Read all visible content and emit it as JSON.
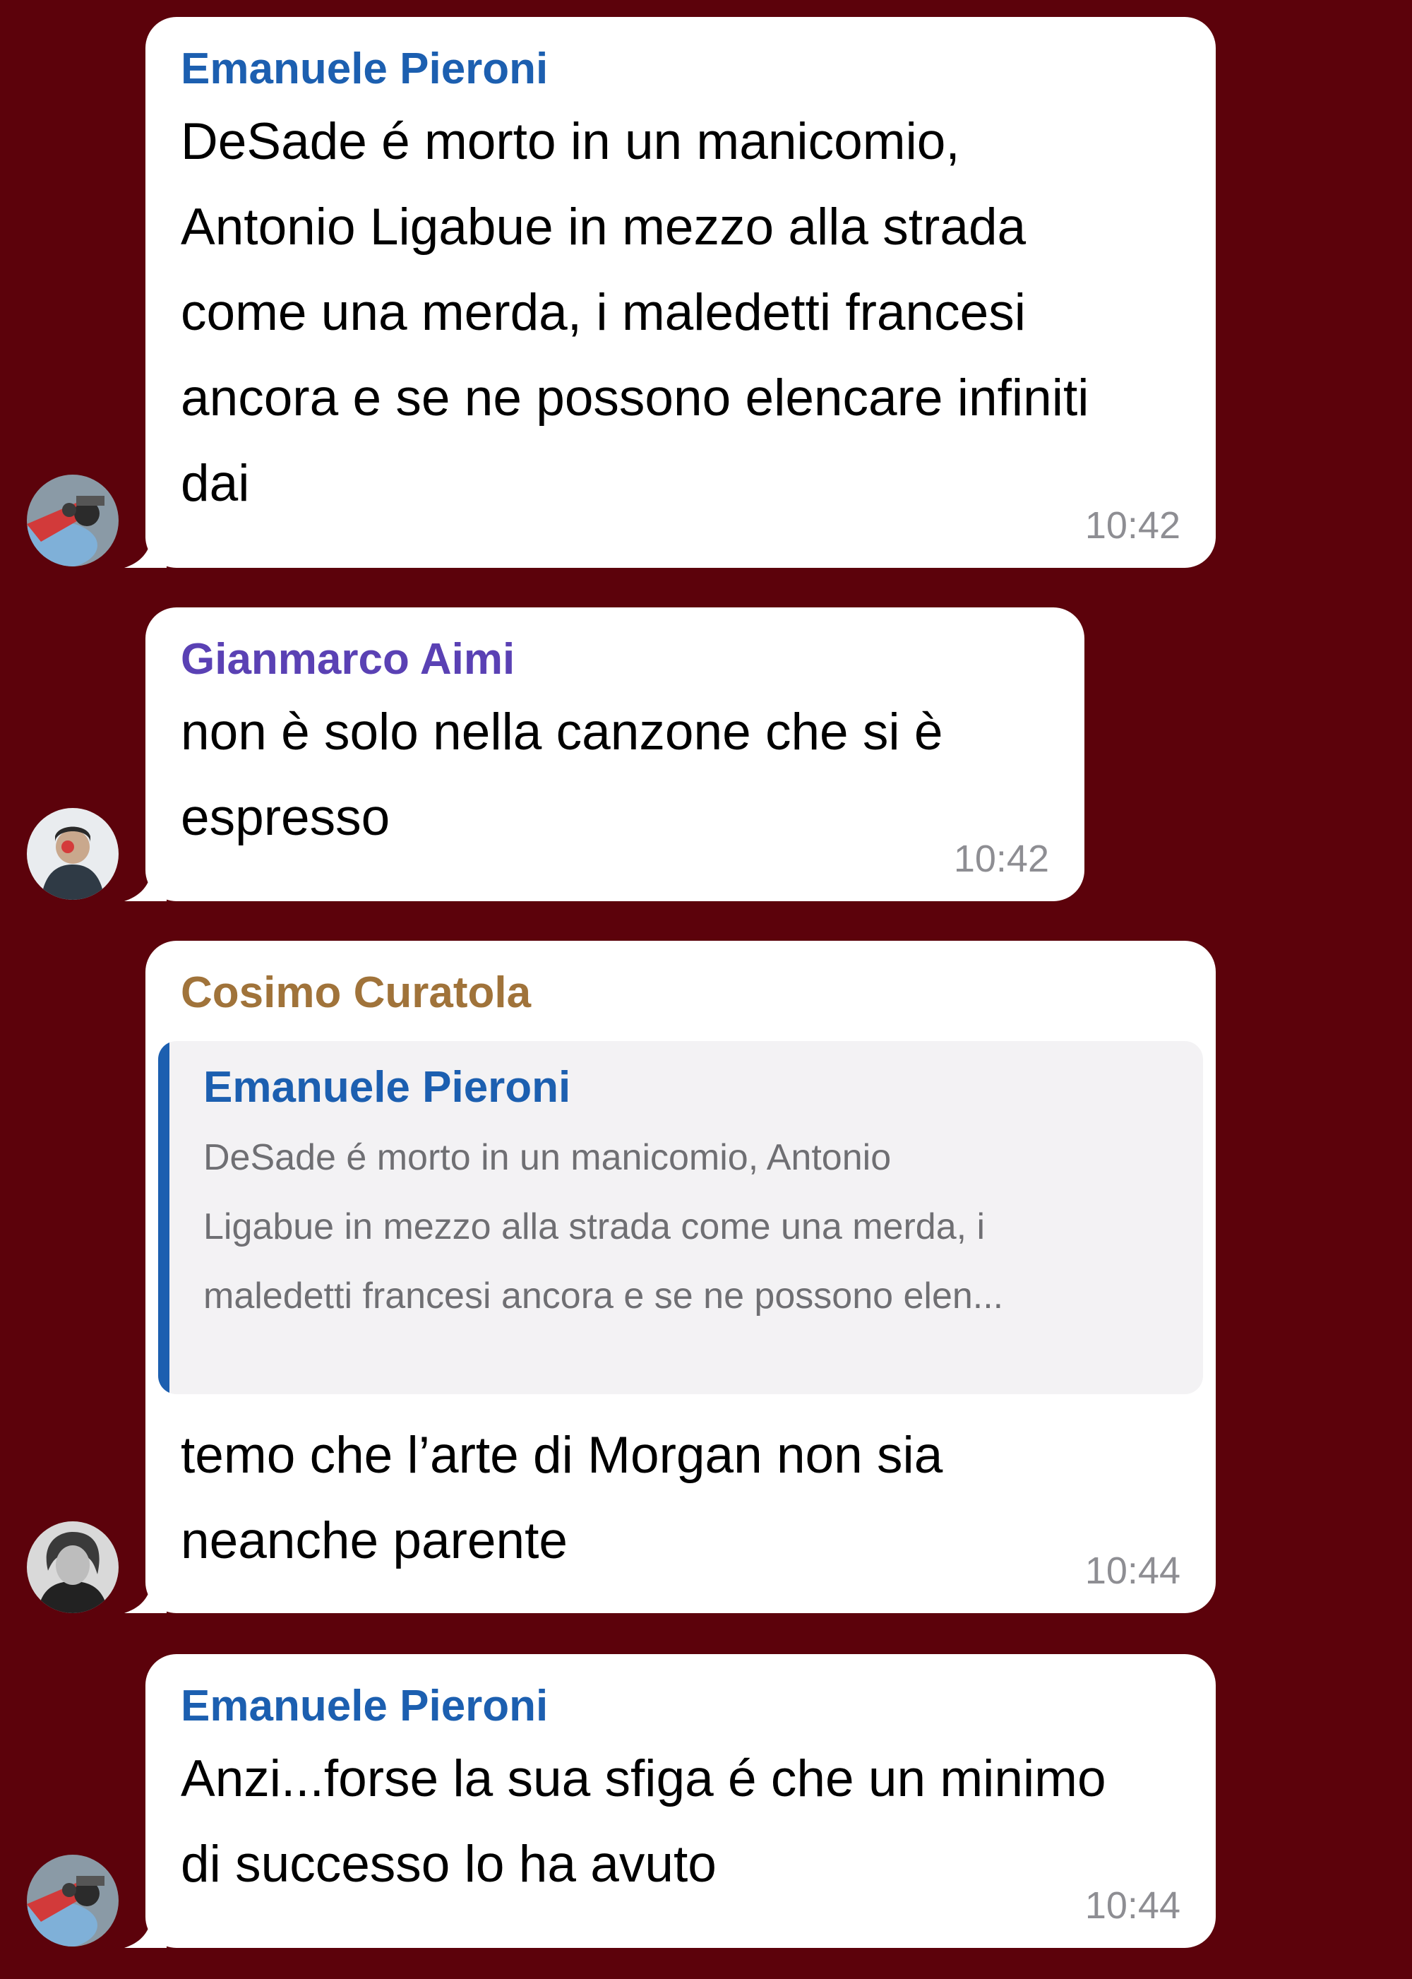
{
  "colors": {
    "background": "#5c020b",
    "bubble": "#ffffff",
    "time": "#8e8e93",
    "quote_background": "#f3f2f4",
    "quote_accent": "#1c5fb0"
  },
  "messages": [
    {
      "sender": "Emanuele Pieroni",
      "sender_color": "#1c5fb0",
      "avatar_icon": "motorcycle-avatar",
      "lines": [
        "DeSade é morto in un manicomio,",
        "Antonio Ligabue in mezzo alla strada",
        "come una merda, i maledetti francesi",
        "ancora e se ne possono elencare infiniti",
        "dai"
      ],
      "time": "10:42"
    },
    {
      "sender": "Gianmarco Aimi",
      "sender_color": "#5a41b4",
      "avatar_icon": "person-avatar",
      "lines": [
        "non è solo nella canzone che si è",
        "espresso"
      ],
      "time": "10:42"
    },
    {
      "sender": "Cosimo Curatola",
      "sender_color": "#a0733a",
      "avatar_icon": "portrait-avatar",
      "reply": {
        "sender": "Emanuele Pieroni",
        "lines": [
          "DeSade é morto in un manicomio, Antonio",
          "Ligabue in mezzo alla strada come una merda, i",
          "maledetti francesi ancora e se ne possono elen..."
        ]
      },
      "lines": [
        "temo che l’arte di Morgan non sia",
        "neanche parente"
      ],
      "time": "10:44"
    },
    {
      "sender": "Emanuele Pieroni",
      "sender_color": "#1c5fb0",
      "avatar_icon": "motorcycle-avatar",
      "lines": [
        "Anzi...forse la sua sfiga é che un minimo",
        "di successo lo ha avuto"
      ],
      "time": "10:44"
    }
  ]
}
